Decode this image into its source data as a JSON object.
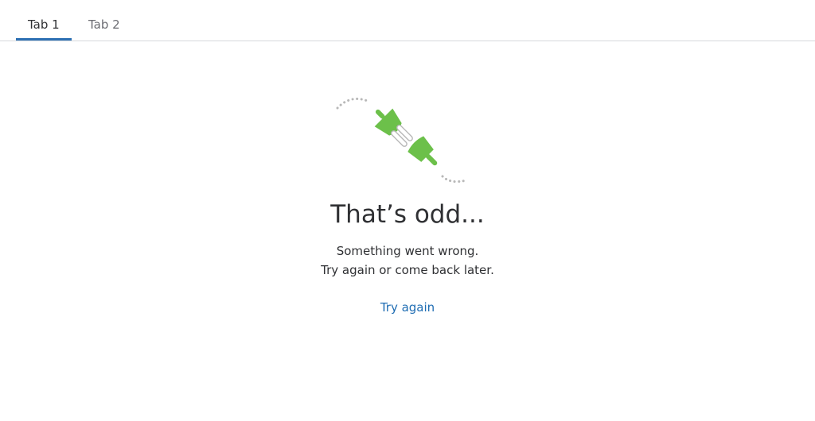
{
  "tabs": [
    {
      "label": "Tab 1",
      "active": true
    },
    {
      "label": "Tab 2",
      "active": false
    }
  ],
  "error": {
    "illustration": "unplugged-plug-icon",
    "title": "That’s odd...",
    "line1": "Something went wrong.",
    "line2": "Try again or come back later.",
    "retry_label": "Try again"
  },
  "colors": {
    "accent": "#2c6fb3",
    "link": "#1f6db3",
    "plug": "#6cc04a",
    "text": "#2f3033",
    "muted": "#6b6c72",
    "divider": "#d6d9dc"
  }
}
